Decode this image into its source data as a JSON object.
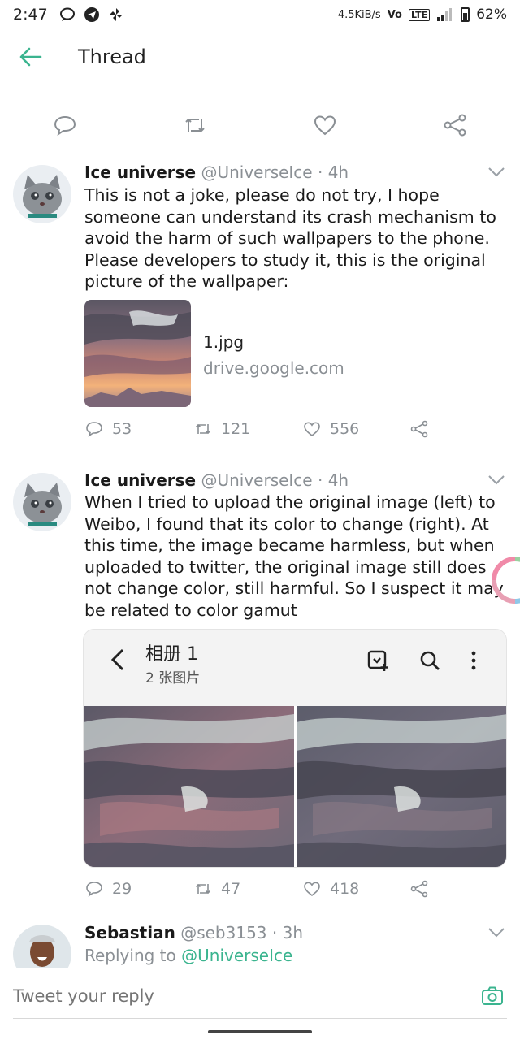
{
  "status_bar": {
    "time": "2:47",
    "speed": "4.5KiB/s",
    "volte": "Vo",
    "lte": "LTE",
    "battery": "62%"
  },
  "header": {
    "title": "Thread",
    "back_icon": "arrow-left-icon"
  },
  "action_bar": {
    "icons": [
      "reply-icon",
      "retweet-icon",
      "like-icon",
      "share-icon"
    ]
  },
  "tweets": [
    {
      "name": "Ice universe",
      "handle": "@UniverseIce",
      "time": "· 4h",
      "lines": [
        "This is not a joke, please do not try, I hope",
        "someone can understand its crash mechanism to",
        "avoid the harm of such wallpapers to the phone.",
        "Please developers to study it, this is the original",
        "picture of the wallpaper:"
      ],
      "link": {
        "title": "1.jpg",
        "domain": "drive.google.com"
      },
      "replies": "53",
      "retweets": "121",
      "likes": "556"
    },
    {
      "name": "Ice universe",
      "handle": "@UniverseIce",
      "time": "· 4h",
      "lines": [
        "When I tried to upload the original image (left) to",
        "Weibo, I found that its color to change (right). At",
        "this time, the image became harmless, but when",
        "uploaded to twitter, the original image still does",
        "not change color, still harmful. So I suspect it may",
        "be related to color gamut"
      ],
      "image": {
        "title": "相册 1",
        "subtitle": "2 张图片"
      },
      "replies": "29",
      "retweets": "47",
      "likes": "418"
    },
    {
      "name": "Sebastian",
      "handle": "@seb3153",
      "time": "· 3h",
      "reply_prefix": "Replying to",
      "reply_to": "@UniverseIce"
    }
  ],
  "reply_bar": {
    "placeholder": "Tweet your reply",
    "camera_icon": "camera-icon"
  },
  "colors": {
    "accent": "#3bb48f",
    "muted": "#8a8f94"
  }
}
